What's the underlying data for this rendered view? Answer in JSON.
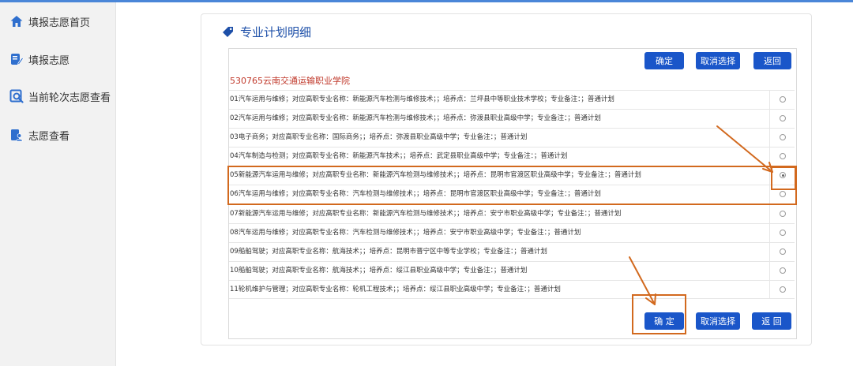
{
  "sidebar": {
    "items": [
      {
        "label": "填报志愿首页",
        "icon": "home-icon"
      },
      {
        "label": "填报志愿",
        "icon": "edit-icon"
      },
      {
        "label": "当前轮次志愿查看",
        "icon": "search-icon"
      },
      {
        "label": "志愿查看",
        "icon": "user-icon"
      }
    ]
  },
  "panel": {
    "title": "专业计划明细",
    "title_icon": "tag-icon",
    "school": "530765云南交通运输职业学院"
  },
  "buttons": {
    "confirm_top": "确定",
    "cancel_top": "取消选择",
    "back_top": "返回",
    "confirm_bottom": "确 定",
    "cancel_bottom": "取消选择",
    "back_bottom": "返 回"
  },
  "rows": [
    {
      "text": "01汽车运用与维修；对应高职专业名称：新能源汽车检测与维修技术；；培养点：兰坪县中等职业技术学校；专业备注：；普通计划",
      "selected": false
    },
    {
      "text": "02汽车运用与维修；对应高职专业名称：新能源汽车检测与维修技术；；培养点：弥渡县职业高级中学；专业备注：；普通计划",
      "selected": false
    },
    {
      "text": "03电子商务；对应高职专业名称：国际商务；；培养点：弥渡县职业高级中学；专业备注：；普通计划",
      "selected": false
    },
    {
      "text": "04汽车制造与检测；对应高职专业名称：新能源汽车技术；；培养点：武定县职业高级中学；专业备注：；普通计划",
      "selected": false
    },
    {
      "text": "05新能源汽车运用与维修；对应高职专业名称：新能源汽车检测与维修技术；；培养点：昆明市官渡区职业高级中学；专业备注：；普通计划",
      "selected": true
    },
    {
      "text": "06汽车运用与维修；对应高职专业名称：汽车检测与维修技术；；培养点：昆明市官渡区职业高级中学；专业备注：；普通计划",
      "selected": false
    },
    {
      "text": "07新能源汽车运用与维修；对应高职专业名称：新能源汽车检测与维修技术；；培养点：安宁市职业高级中学；专业备注：；普通计划",
      "selected": false
    },
    {
      "text": "08汽车运用与维修；对应高职专业名称：汽车检测与维修技术；；培养点：安宁市职业高级中学；专业备注：；普通计划",
      "selected": false
    },
    {
      "text": "09船舶驾驶；对应高职专业名称：航海技术；；培养点：昆明市晋宁区中等专业学校；专业备注：；普通计划",
      "selected": false
    },
    {
      "text": "10船舶驾驶；对应高职专业名称：航海技术；；培养点：绥江县职业高级中学；专业备注：；普通计划",
      "selected": false
    },
    {
      "text": "11轮机维护与管理；对应高职专业名称：轮机工程技术；；培养点：绥江县职业高级中学；专业备注：；普通计划",
      "selected": false
    }
  ],
  "colors": {
    "accent": "#1a56c9",
    "school_red": "#c0392b",
    "annotation_orange": "#d2691e"
  }
}
